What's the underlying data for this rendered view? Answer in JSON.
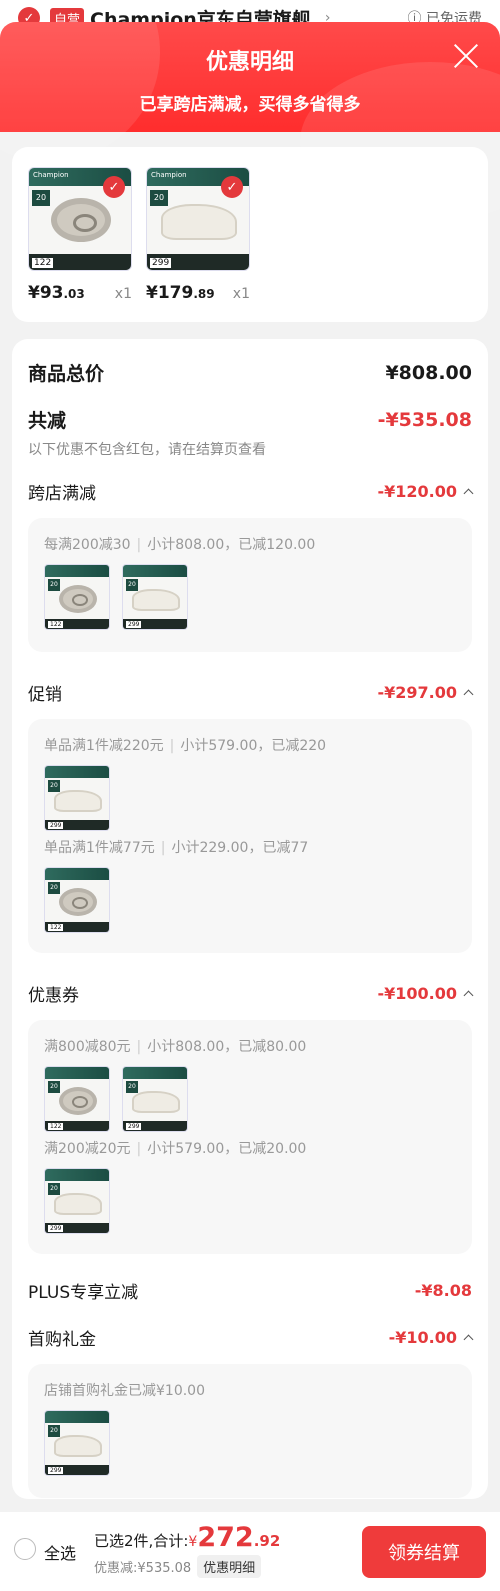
{
  "store": {
    "tag": "自营",
    "name": "Champion京东自营旗舰",
    "shipping": "ⓘ 已免运费"
  },
  "header": {
    "title": "优惠明细",
    "subtitle": "已享跨店满减，买得多省得多"
  },
  "products": [
    {
      "price_int": "¥93",
      "price_dec": ".03",
      "qty": "x1",
      "thumb_price": "122",
      "kind": "bag"
    },
    {
      "price_int": "¥179",
      "price_dec": ".89",
      "qty": "x1",
      "thumb_price": "299",
      "kind": "shoe"
    }
  ],
  "summary": {
    "total_label": "商品总价",
    "total_value": "¥808.00",
    "minus_label": "共减",
    "minus_value": "-¥535.08",
    "note": "以下优惠不包含红包，请在结算页查看"
  },
  "sections": {
    "cross": {
      "label": "跨店满减",
      "value": "-¥120.00",
      "rules": [
        {
          "a": "每满200减30",
          "b": "小计808.00，已减120.00"
        }
      ]
    },
    "promo": {
      "label": "促销",
      "value": "-¥297.00",
      "rules": [
        {
          "a": "单品满1件减220元",
          "b": "小计579.00，已减220"
        },
        {
          "a": "单品满1件减77元",
          "b": "小计229.00，已减77"
        }
      ]
    },
    "coupon": {
      "label": "优惠券",
      "value": "-¥100.00",
      "rules": [
        {
          "a": "满800减80元",
          "b": "小计808.00，已减80.00"
        },
        {
          "a": "满200减20元",
          "b": "小计579.00，已减20.00"
        }
      ]
    },
    "plus": {
      "label": "PLUS专享立减",
      "value": "-¥8.08"
    },
    "gift": {
      "label": "首购礼金",
      "value": "-¥10.00",
      "rules": [
        {
          "a": "店铺首购礼金已减¥10.00"
        }
      ]
    }
  },
  "bottom": {
    "select_all": "全选",
    "selected": "已选2件,合计:",
    "yen": "¥",
    "amount": "272",
    "decimal": ".92",
    "discount": "优惠减:¥535.08",
    "detail_chip": "优惠明细",
    "pay_button": "领券结算"
  },
  "colors": {
    "accent": "#e4393c",
    "header_gradient": "#ff2d2d"
  }
}
